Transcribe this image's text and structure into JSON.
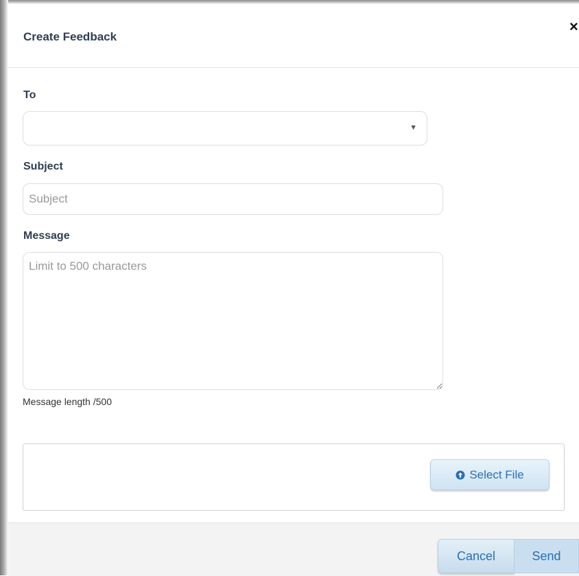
{
  "dialog": {
    "title": "Create Feedback",
    "close_label": "×"
  },
  "form": {
    "to": {
      "label": "To",
      "selected_value": ""
    },
    "subject": {
      "label": "Subject",
      "placeholder": "Subject",
      "value": ""
    },
    "message": {
      "label": "Message",
      "placeholder": "Limit to 500 characters",
      "value": "",
      "length_text": "Message length /500"
    },
    "attachment": {
      "select_file_label": "Select File",
      "icon": "upload-circle-icon"
    }
  },
  "footer": {
    "cancel_label": "Cancel",
    "send_label": "Send"
  },
  "colors": {
    "title_text": "#2f3e4f",
    "button_text": "#2a6fb0",
    "footer_bg": "#f3f3f3"
  }
}
